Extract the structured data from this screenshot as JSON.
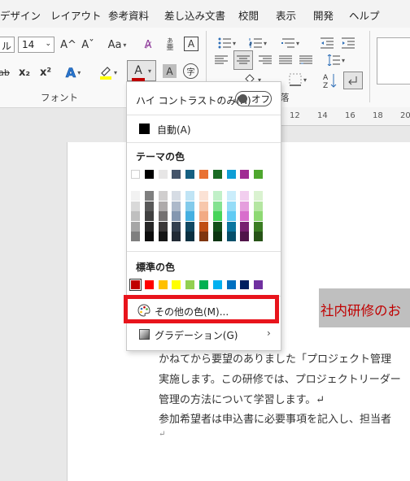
{
  "menu": [
    "デザイン",
    "レイアウト",
    "参考資料",
    "差し込み文書",
    "校閲",
    "表示",
    "開発",
    "ヘルプ"
  ],
  "ribbon": {
    "font_name_partial": "ル",
    "font_size": "14",
    "grow_font": "A^",
    "shrink_font": "Aˇ",
    "change_case": "Aa",
    "strike": "ab",
    "subscript": "x₂",
    "superscript": "x²",
    "text_effect": "A",
    "font_color_glyph": "A",
    "char_shading_glyph": "A",
    "enclose_char_glyph": "字",
    "phonetic_glyph": "亜",
    "char_border_glyph": "A",
    "font_group_label": "フォント",
    "paragraph_group_label_partial": "落",
    "highlight_color": "#ffff00",
    "font_color_bar": "#c00000"
  },
  "ruler": [
    "12",
    "14",
    "16",
    "18",
    "20"
  ],
  "dropdown": {
    "high_contrast_label": "ハイ コントラストのみ(H)",
    "toggle_state": "オフ",
    "auto_label": "自動(A)",
    "auto_color": "#000000",
    "theme_colors_label": "テーマの色",
    "theme_top_row": [
      "#ffffff",
      "#000000",
      "#e7e6e6",
      "#44546a",
      "#156082",
      "#e97132",
      "#196b24",
      "#0f9ed5",
      "#a02b93",
      "#4ea72e"
    ],
    "theme_shades": [
      [
        "#f2f2f2",
        "#d9d9d9",
        "#bfbfbf",
        "#a6a6a6",
        "#7f7f7f"
      ],
      [
        "#7f7f7f",
        "#595959",
        "#404040",
        "#262626",
        "#0d0d0d"
      ],
      [
        "#d0cece",
        "#aeaaaa",
        "#757171",
        "#3b3838",
        "#161616"
      ],
      [
        "#d6dce4",
        "#adb9ca",
        "#8497b0",
        "#333f4f",
        "#222a35"
      ],
      [
        "#c0e4f5",
        "#83cbeb",
        "#45b0e1",
        "#104862",
        "#0a3041"
      ],
      [
        "#fbe2d5",
        "#f7c7ac",
        "#f2aa84",
        "#c04f15",
        "#7f350e"
      ],
      [
        "#c1f0c8",
        "#84e291",
        "#47d45a",
        "#12501a",
        "#0d3512"
      ],
      [
        "#caedfb",
        "#95dcf7",
        "#61cbf3",
        "#0b769f",
        "#074f6a"
      ],
      [
        "#f2ceef",
        "#e59edd",
        "#d86ecc",
        "#782070",
        "#501549"
      ],
      [
        "#daf2d0",
        "#b5e6a2",
        "#8ed973",
        "#3b7d23",
        "#275317"
      ]
    ],
    "standard_colors_label": "標準の色",
    "standard_colors": [
      "#c00000",
      "#ff0000",
      "#ffc000",
      "#ffff00",
      "#92d050",
      "#00b050",
      "#00b0f0",
      "#0070c0",
      "#002060",
      "#7030a0"
    ],
    "more_colors_label": "その他の色(M)...",
    "gradient_label": "グラデーション(G)"
  },
  "document": {
    "heading_partial": "社内研修のお",
    "line1": "かねてから要望のありました「プロジェクト管理",
    "line2": "実施します。この研修では、プロジェクトリーダー",
    "line3": "管理の方法について学習します。↵",
    "line4": "参加希望者は申込書に必要事項を記入し、担当者",
    "line5": "↵",
    "heading_color": "#c00000",
    "heading_bg": "#bfbfbf"
  }
}
